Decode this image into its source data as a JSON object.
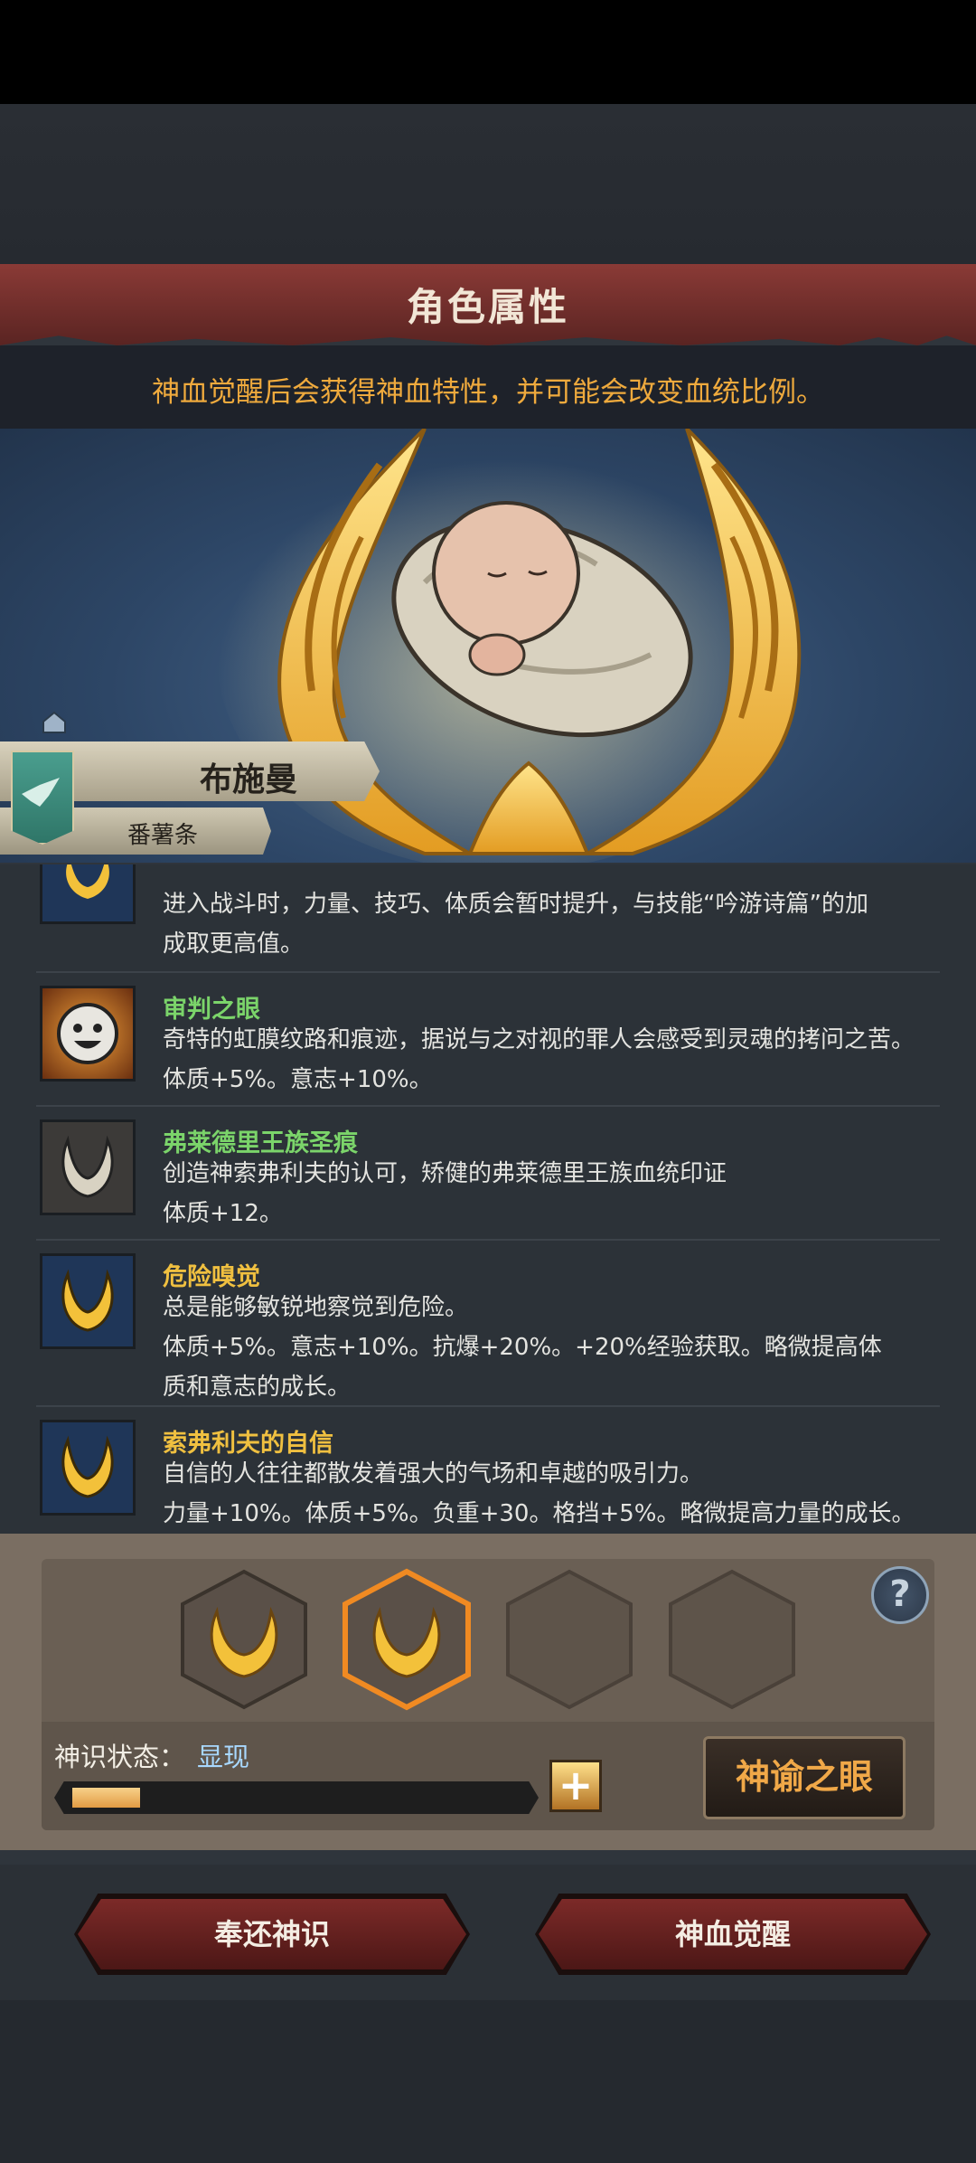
{
  "header": {
    "title": "角色属性",
    "subtitle": "神血觉醒后会获得神血特性，并可能会改变血统比例。"
  },
  "character": {
    "name": "布施曼",
    "subname": "番薯条"
  },
  "traits": [
    {
      "name": "",
      "desc": "进入战斗时，力量、技巧、体质会暂时提升，与技能“吟游诗篇”的加成取更高值。",
      "icon": "golden-wings-icon"
    },
    {
      "name": "审判之眼",
      "name_color": "#7bd46a",
      "desc": "奇特的虹膜纹路和痕迹，据说与之对视的罪人会感受到灵魂的拷问之苦。体质+5%。意志+10%。",
      "icon": "smiley-face-icon"
    },
    {
      "name": "弗莱德里王族圣痕",
      "name_color": "#7bd46a",
      "desc": "创造神索弗利夫的认可，矫健的弗莱德里王族血统印证体质+12。",
      "icon": "silver-wings-icon"
    },
    {
      "name": "危险嗅觉",
      "name_color": "#f0c040",
      "desc": "总是能够敏锐地察觉到危险。体质+5%。意志+10%。抗爆+20%。+20%经验获取。略微提高体质和意志的成长。",
      "icon": "golden-wings-icon"
    },
    {
      "name": "索弗利夫的自信",
      "name_color": "#f0c040",
      "desc": "自信的人往往都散发着强大的气场和卓越的吸引力。力量+10%。体质+5%。负重+30。格挡+5%。略微提高力量的成长。",
      "icon": "golden-wings-icon"
    }
  ],
  "trait_lines": [
    [
      "进入战斗时，力量、技巧、体质会暂时提升，与技能“吟游诗篇”的加",
      "成取更高值。"
    ],
    [
      "奇特的虹膜纹路和痕迹，据说与之对视的罪人会感受到灵魂的拷问之苦。",
      "体质+5%。意志+10%。"
    ],
    [
      "创造神索弗利夫的认可，矫健的弗莱德里王族血统印证",
      "体质+12。"
    ],
    [
      "总是能够敏锐地察觉到危险。",
      "体质+5%。意志+10%。抗爆+20%。+20%经验获取。略微提高体",
      "质和意志的成长。"
    ],
    [
      "自信的人往往都散发着强大的气场和卓越的吸引力。",
      "力量+10%。体质+5%。负重+30。格挡+5%。略微提高力量的成长。"
    ]
  ],
  "slots": {
    "filled": 2,
    "total": 4,
    "selected_index": 1,
    "help_label": "?"
  },
  "divine_state": {
    "label": "神识状态：",
    "value": "显现",
    "progress": 0.15,
    "plus_label": "+"
  },
  "buttons": {
    "oracle": "神谕之眼",
    "return": "奉还神识",
    "awaken": "神血觉醒"
  },
  "colors": {
    "accent_orange": "#efaa3d",
    "banner_red": "#8a3a36",
    "trait_green": "#7bd46a",
    "trait_gold": "#f0c040",
    "state_blue": "#a8d8ff"
  }
}
